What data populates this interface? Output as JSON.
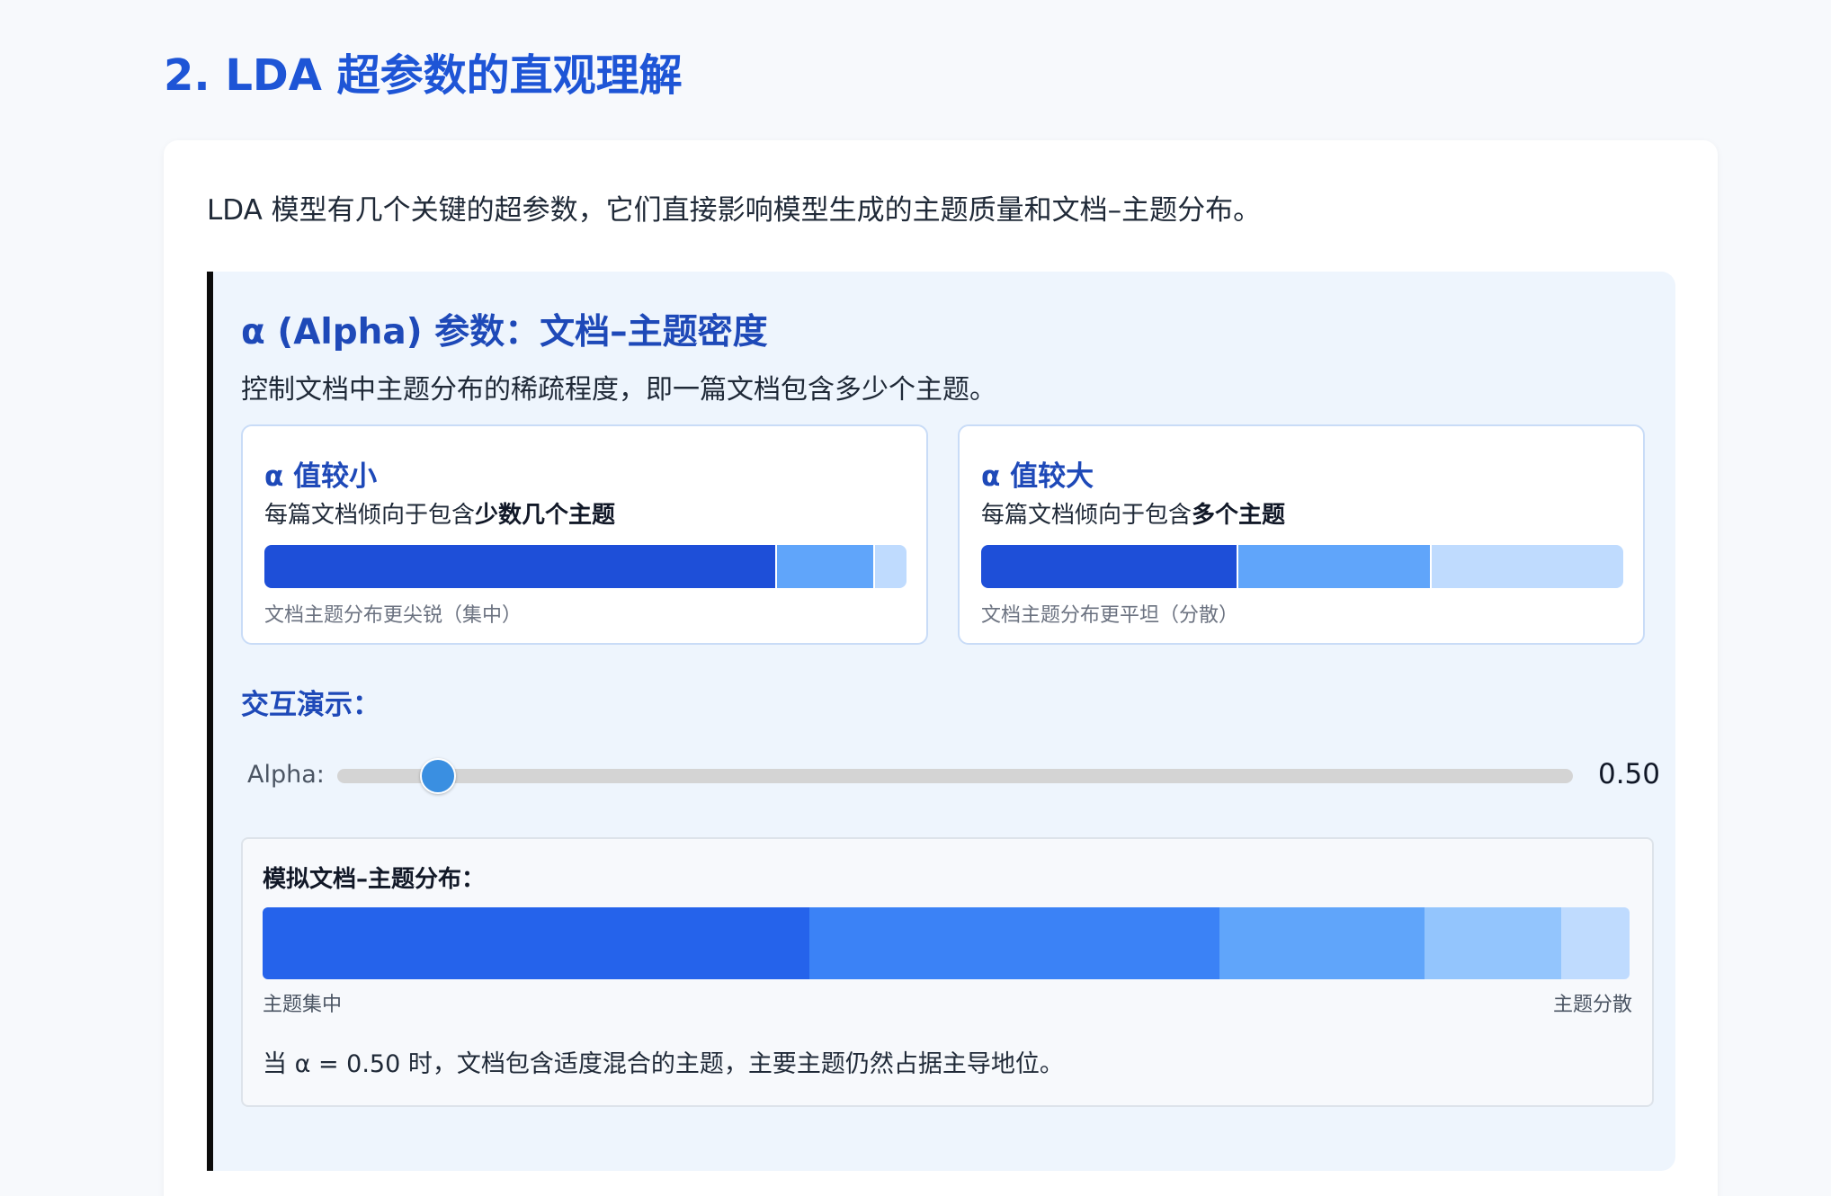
{
  "section": {
    "title": "2. LDA 超参数的直观理解"
  },
  "intro": "LDA 模型有几个关键的超参数，它们直接影响模型生成的主题质量和文档–主题分布。",
  "alpha": {
    "title": "α (Alpha) 参数：文档–主题密度",
    "description": "控制文档中主题分布的稀疏程度，即一篇文档包含多少个主题。",
    "small": {
      "title": "α 值较小",
      "desc_prefix": "每篇文档倾向于包含",
      "desc_bold": "少数几个主题",
      "caption": "文档主题分布更尖锐（集中）",
      "segments": [
        {
          "share": 0.8,
          "color": "#1e4fd8"
        },
        {
          "share": 0.15,
          "color": "#60a5fa"
        },
        {
          "share": 0.05,
          "color": "#bfdbfe"
        }
      ]
    },
    "large": {
      "title": "α 值较大",
      "desc_prefix": "每篇文档倾向于包含",
      "desc_bold": "多个主题",
      "caption": "文档主题分布更平坦（分散）",
      "segments": [
        {
          "share": 0.4,
          "color": "#1e4fd8"
        },
        {
          "share": 0.3,
          "color": "#60a5fa"
        },
        {
          "share": 0.3,
          "color": "#bfdbfe"
        }
      ]
    },
    "demo_label": "交互演示：",
    "slider": {
      "label": "Alpha:",
      "value": 0.5,
      "value_text": "0.50",
      "min": 0.1,
      "max": 5
    },
    "simulation": {
      "title": "模拟文档–主题分布：",
      "left_label": "主题集中",
      "right_label": "主题分散",
      "segments": [
        {
          "share": 0.4,
          "color": "#2563eb"
        },
        {
          "share": 0.3,
          "color": "#3b82f6"
        },
        {
          "share": 0.15,
          "color": "#60a5fa"
        },
        {
          "share": 0.1,
          "color": "#93c5fd"
        },
        {
          "share": 0.05,
          "color": "#bfdbfe"
        }
      ],
      "note": "当 α = 0.50 时，文档包含适度混合的主题，主要主题仍然占据主导地位。"
    }
  }
}
